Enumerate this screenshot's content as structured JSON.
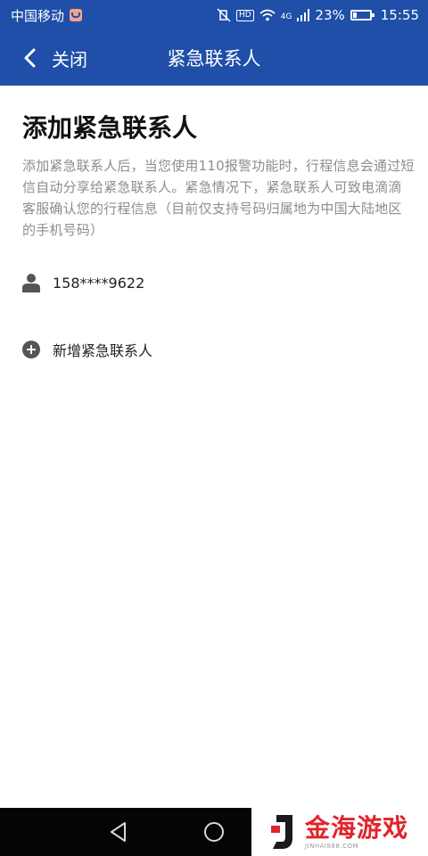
{
  "status_bar": {
    "carrier": "中国移动",
    "network": "4G",
    "battery": "23%",
    "time": "15:55"
  },
  "app_bar": {
    "close_label": "关闭",
    "title": "紧急联系人"
  },
  "page": {
    "heading": "添加紧急联系人",
    "description": "添加紧急联系人后，当您使用110报警功能时，行程信息会通过短信自动分享给紧急联系人。紧急情况下，紧急联系人可致电滴滴客服确认您的行程信息（目前仅支持号码归属地为中国大陆地区的手机号码）",
    "contacts": [
      {
        "phone": "158****9622",
        "icon": "person-icon"
      }
    ],
    "add_contact_label": "新增紧急联系人"
  },
  "nav_bar": {
    "back_icon": "triangle-back-icon",
    "home_icon": "circle-home-icon"
  },
  "watermark": {
    "text": "金海游戏",
    "sub": "JINHAI888.COM"
  },
  "colors": {
    "primary": "#1f4fa8",
    "heading": "#111111",
    "description": "#8d8d8d",
    "icon": "#555555",
    "watermark_red": "#e0242b"
  }
}
